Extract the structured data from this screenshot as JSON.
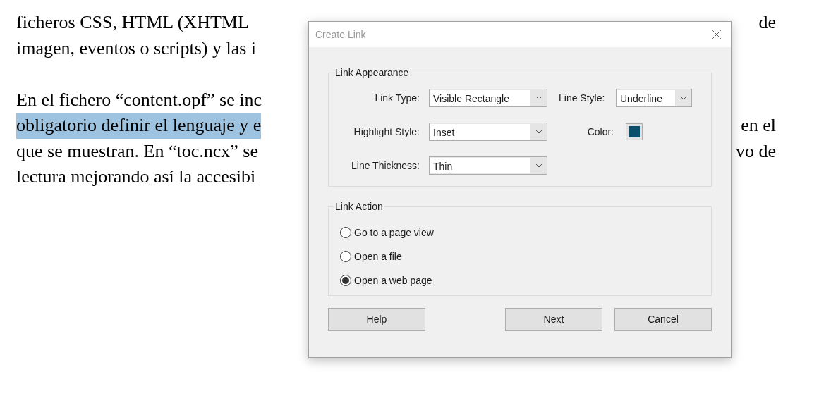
{
  "document": {
    "paragraphs": [
      {
        "lines": [
          {
            "left": "ficheros CSS, HTML (XHTML",
            "right": "de",
            "highlighted": false
          },
          {
            "left": "imagen, eventos o scripts) y las i",
            "highlighted": false
          }
        ]
      },
      {
        "lines": [
          {
            "left": "En el fichero “content.opf” se inc",
            "highlighted": false
          },
          {
            "left": "obligatorio definir el lenguaje y e",
            "right": "en el",
            "highlighted": true
          },
          {
            "left": "que se muestran. En “toc.ncx” se",
            "right": "vo de",
            "highlighted": false
          },
          {
            "left": "lectura mejorando así la accesibi",
            "highlighted": false
          }
        ]
      }
    ]
  },
  "dialog": {
    "title": "Create Link",
    "link_appearance": {
      "title": "Link Appearance",
      "link_type": {
        "label": "Link Type:",
        "value": "Visible Rectangle"
      },
      "line_style": {
        "label": "Line Style:",
        "value": "Underline"
      },
      "highlight_style": {
        "label": "Highlight Style:",
        "value": "Inset"
      },
      "color": {
        "label": "Color:",
        "color": "#0b4f6c"
      },
      "line_thickness": {
        "label": "Line Thickness:",
        "value": "Thin"
      }
    },
    "link_action": {
      "title": "Link Action",
      "options": [
        {
          "label": "Go to a page view",
          "selected": false
        },
        {
          "label": "Open a file",
          "selected": false
        },
        {
          "label": "Open a web page",
          "selected": true
        }
      ]
    },
    "buttons": [
      {
        "label": "Help"
      },
      {
        "label": "Next"
      },
      {
        "label": "Cancel"
      }
    ]
  }
}
